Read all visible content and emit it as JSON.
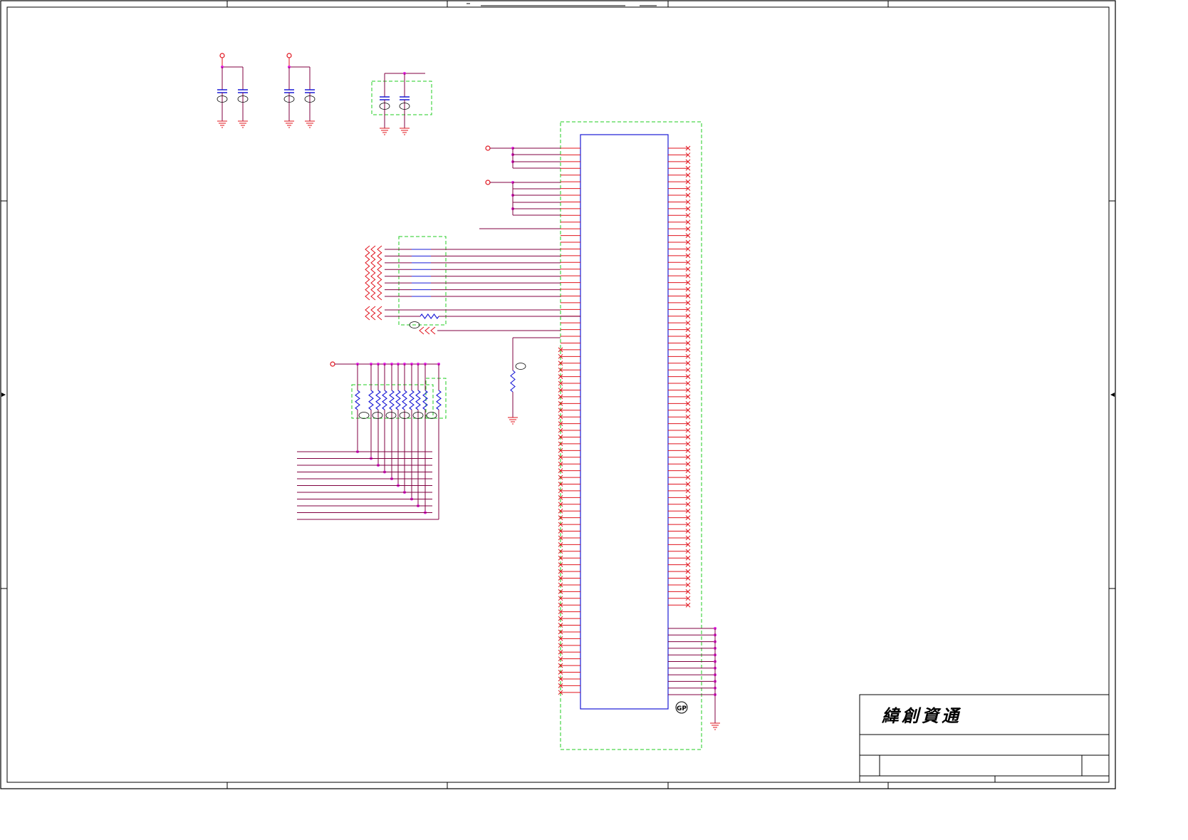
{
  "title_block": {
    "company_name": "緯創資通"
  },
  "labels": {
    "gp_tag": "GP"
  },
  "colors": {
    "wire": "#e0141e",
    "bus": "#800040",
    "component": "#1a1ad6",
    "junction": "#e020e0",
    "group_box": "#22cc22",
    "frame": "#000000"
  },
  "icons": {
    "power_port": "circle-port-icon",
    "ground": "ground-symbol-icon",
    "capacitor": "capacitor-icon",
    "resistor": "resistor-icon",
    "no_connect": "x-mark-icon",
    "off_sheet": "chevron-connector-icon"
  }
}
